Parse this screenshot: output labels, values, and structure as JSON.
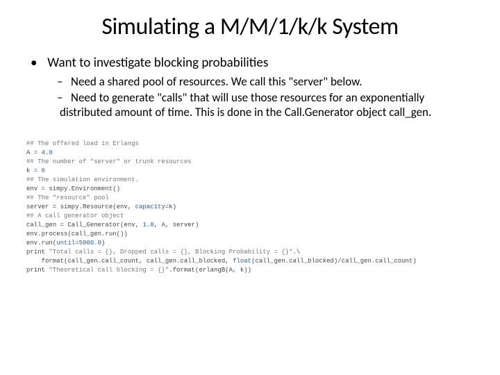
{
  "title": "Simulating a M/M/1/k/k System",
  "bullet1": "Want to investigate blocking probabilities",
  "sub1": "Need a shared pool of resources. We call this \"server\" below.",
  "sub2": "Need to generate \"calls\" that will use those resources for an exponentially distributed amount of time. This is done in the Call.Generator object call_gen.",
  "code": {
    "l01": "## The offered load in Erlangs",
    "l02a": "A = ",
    "l02b": "4.0",
    "l03": "## The number of \"server\" or trunk resources",
    "l04a": "k = ",
    "l04b": "6",
    "l05": "## The simulation environment.",
    "l06": "env = simpy.Environment()",
    "l07": "## The \"resource\" pool",
    "l08a": "server = simpy.Resource(env, ",
    "l08b": "capacity",
    "l08c": "=k)",
    "l09": "## A call generator object",
    "l10a": "call_gen = Call_Generator(env, ",
    "l10b": "1.0",
    "l10c": ", A, server)",
    "l11": "env.process(call_gen.run())",
    "l12a": "env.run(",
    "l12b": "until",
    "l12c": "=",
    "l12d": "5000.0",
    "l12e": ")",
    "l13a": "print ",
    "l13b": "\"Total calls = {}, Dropped calls = {}, Blocking Probability = {}\"",
    "l13c": ".\\",
    "l14a": "    format(call_gen.call_count, call_gen.call_blocked, ",
    "l14b": "float",
    "l14c": "(call_gen.call_blocked)/call_gen.call_count)",
    "l15a": "print ",
    "l15b": "\"Theoretical call blocking = {}\"",
    "l15c": ".format(erlangB(A, k))"
  }
}
